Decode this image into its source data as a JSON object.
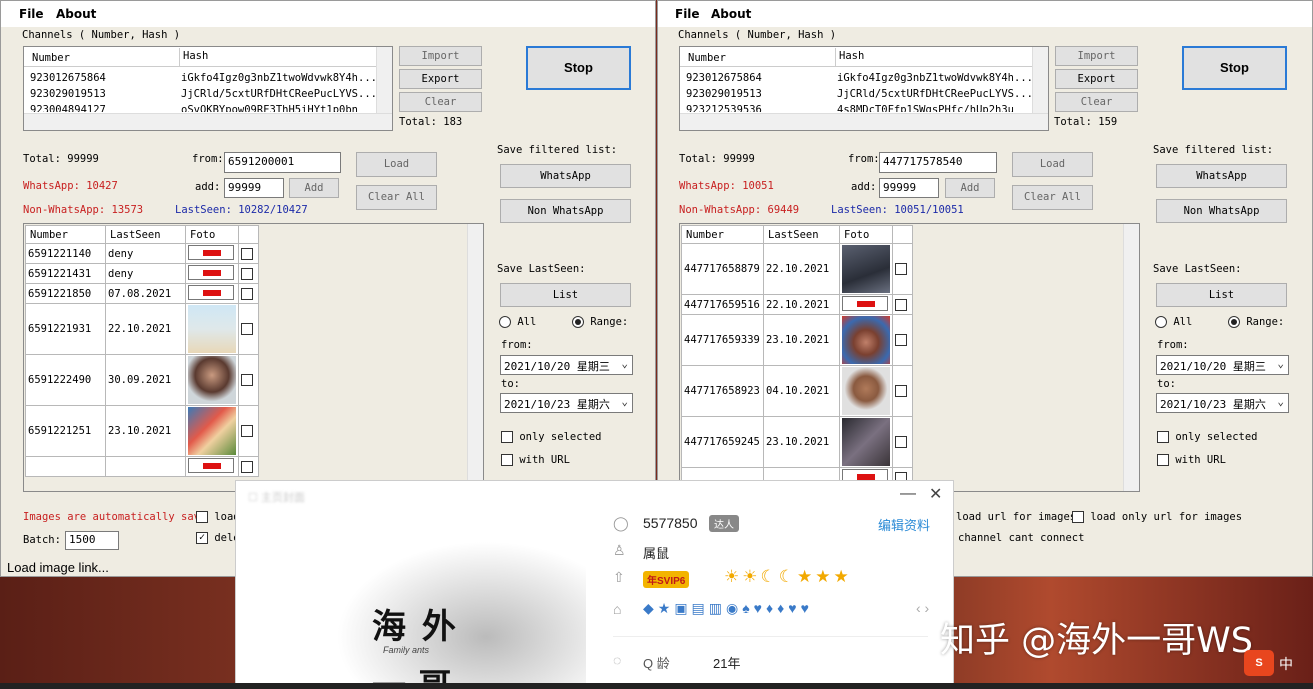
{
  "menu": {
    "file": "File",
    "about": "About"
  },
  "left": {
    "channels_label": "Channels ( Number, Hash )",
    "channel_cols": [
      "Number",
      "Hash"
    ],
    "channels": [
      {
        "number": "923012675864",
        "hash": "iGkfo4Igz0g3nbZ1twoWdvwk8Y4h..."
      },
      {
        "number": "923029019513",
        "hash": "JjCRld/5cxtURfDHtCReePucLYVS..."
      },
      {
        "number": "923004894127",
        "hash": "oSvOKBYpow09RF3ThH5iHYt1p0bn"
      }
    ],
    "import": "Import",
    "export": "Export",
    "clear": "Clear",
    "total_channels": "Total: 183",
    "stop": "Stop",
    "total": "Total: 99999",
    "whatsapp": "WhatsApp: 10427",
    "non_whatsapp": "Non-WhatsApp: 13573",
    "lastseen": "LastSeen: 10282/10427",
    "from_label": "from:",
    "from_value": "6591200001",
    "add_label": "add:",
    "add_value": "99999",
    "add_btn": "Add",
    "load_btn": "Load",
    "clear_all": "Clear All",
    "result_cols": [
      "Number",
      "LastSeen",
      "Foto"
    ],
    "rows": [
      {
        "number": "6591221140",
        "lastseen": "deny",
        "photo": "none"
      },
      {
        "number": "6591221431",
        "lastseen": "deny",
        "photo": "none"
      },
      {
        "number": "6591221850",
        "lastseen": "07.08.2021",
        "photo": "none"
      },
      {
        "number": "6591221931",
        "lastseen": "22.10.2021",
        "photo": "baby-with-teddy"
      },
      {
        "number": "6591222490",
        "lastseen": "30.09.2021",
        "photo": "woman-portrait"
      },
      {
        "number": "6591221251",
        "lastseen": "23.10.2021",
        "photo": "couple"
      },
      {
        "number": "",
        "lastseen": "",
        "photo": "none"
      }
    ],
    "save_filtered": "Save filtered list:",
    "whatsapp_btn": "WhatsApp",
    "non_whatsapp_btn": "Non WhatsApp",
    "save_lastseen": "Save LastSeen:",
    "list_btn": "List",
    "all": "All",
    "range": "Range:",
    "from2": "from:",
    "date_from": "2021/10/20  星期三",
    "to": "to:",
    "date_to": "2021/10/23  星期六",
    "only_selected": "only selected",
    "with_url": "with URL",
    "images_note": "Images are automatically save",
    "load_opt": "load",
    "batch_label": "Batch:",
    "batch_value": "1500",
    "dele_opt": "dele",
    "status": "Load image link..."
  },
  "right": {
    "channels_label": "Channels ( Number, Hash )",
    "channel_cols": [
      "Number",
      "Hash"
    ],
    "channels": [
      {
        "number": "923012675864",
        "hash": "iGkfo4Igz0g3nbZ1twoWdvwk8Y4h..."
      },
      {
        "number": "923029019513",
        "hash": "JjCRld/5cxtURfDHtCReePucLYVS..."
      },
      {
        "number": "923212539536",
        "hash": "4s8MDcT0Ffp1SWgsPHfc/hUp2h3u"
      }
    ],
    "import": "Import",
    "export": "Export",
    "clear": "Clear",
    "total_channels": "Total: 159",
    "stop": "Stop",
    "total": "Total: 99999",
    "whatsapp": "WhatsApp: 10051",
    "non_whatsapp": "Non-WhatsApp: 69449",
    "lastseen": "LastSeen: 10051/10051",
    "from_label": "from:",
    "from_value": "447717578540",
    "add_label": "add:",
    "add_value": "99999",
    "add_btn": "Add",
    "load_btn": "Load",
    "clear_all": "Clear All",
    "result_cols": [
      "Number",
      "LastSeen",
      "Foto"
    ],
    "rows": [
      {
        "number": "447717658879",
        "lastseen": "22.10.2021",
        "photo": "dark-gradient"
      },
      {
        "number": "447717659516",
        "lastseen": "22.10.2021",
        "photo": "none"
      },
      {
        "number": "447717659339",
        "lastseen": "23.10.2021",
        "photo": "man-sunglasses"
      },
      {
        "number": "447717658923",
        "lastseen": "04.10.2021",
        "photo": "bald-man"
      },
      {
        "number": "447717659245",
        "lastseen": "23.10.2021",
        "photo": "people-indoor"
      }
    ],
    "save_filtered": "Save filtered list:",
    "whatsapp_btn": "WhatsApp",
    "non_whatsapp_btn": "Non WhatsApp",
    "save_lastseen": "Save LastSeen:",
    "list_btn": "List",
    "all": "All",
    "range": "Range:",
    "from2": "from:",
    "date_from": "2021/10/20  星期三",
    "to": "to:",
    "date_to": "2021/10/23  星期六",
    "only_selected": "only selected",
    "with_url": "with URL",
    "load_url": "load url for images",
    "load_only_url": "load only url for images",
    "channel_cant": "channel cant connect"
  },
  "qq": {
    "title_blur": "主页封面",
    "qq_number": "5577850",
    "badge": "达人",
    "edit": "编辑资料",
    "zodiac": "属鼠",
    "svip": "年SVIP6",
    "age_label": "Q 龄",
    "age_value": "21年",
    "calligraphy1": "海 外",
    "calligraphy_sub": "Family ants",
    "calligraphy2": "一 哥"
  },
  "watermark": "知乎 @海外一哥WS",
  "tray": "中"
}
